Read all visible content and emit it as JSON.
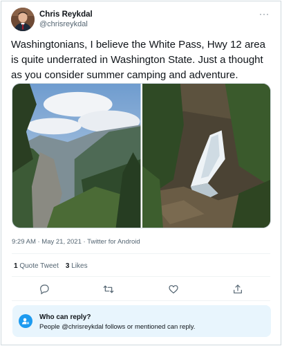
{
  "author": {
    "display_name": "Chris Reykdal",
    "handle": "@chrisreykdal"
  },
  "more_menu": "···",
  "tweet": {
    "text": "Washingtonians, I believe the White Pass, Hwy 12 area is quite underrated in Washington State.  Just a thought as you consider summer camping and adventure.",
    "photos": [
      "mountain-valley-photo",
      "waterfall-photo"
    ]
  },
  "meta": {
    "text": "9:29 AM · May 21, 2021 · Twitter for Android"
  },
  "stats": {
    "quote_count": "1",
    "quote_label": "Quote Tweet",
    "like_count": "3",
    "like_label": "Likes"
  },
  "actions": [
    "reply-icon",
    "retweet-icon",
    "like-icon",
    "share-icon"
  ],
  "reply_settings": {
    "title": "Who can reply?",
    "description": "People @chrisreykdal follows or mentioned can reply."
  },
  "colors": {
    "accent": "#1d9bf0",
    "reply_box_bg": "#e8f5fd",
    "secondary_text": "#536471",
    "border": "#cfd9de"
  }
}
